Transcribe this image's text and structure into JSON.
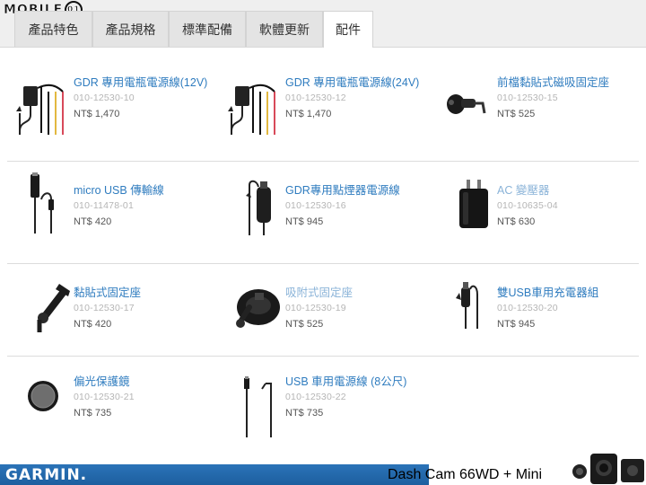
{
  "watermark": {
    "text": "MOBILE",
    "mark": "01"
  },
  "tabs": [
    {
      "label": "產品特色"
    },
    {
      "label": "產品規格"
    },
    {
      "label": "標準配備"
    },
    {
      "label": "軟體更新"
    },
    {
      "label": "配件",
      "active": true
    }
  ],
  "accessories": [
    {
      "name": "GDR 專用電瓶電源線(12V)",
      "sku": "010-12530-10",
      "price": "NT$ 1,470",
      "icon": "battery-cable-icon"
    },
    {
      "name": "GDR 專用電瓶電源線(24V)",
      "sku": "010-12530-12",
      "price": "NT$ 1,470",
      "icon": "battery-cable-icon"
    },
    {
      "name": "前檔黏貼式磁吸固定座",
      "sku": "010-12530-15",
      "price": "NT$ 525",
      "icon": "magnetic-mount-icon"
    },
    {
      "name": "micro USB 傳輸線",
      "sku": "010-11478-01",
      "price": "NT$ 420",
      "icon": "usb-cable-icon"
    },
    {
      "name": "GDR專用點煙器電源線",
      "sku": "010-12530-16",
      "price": "NT$ 945",
      "icon": "car-charger-icon"
    },
    {
      "name": "AC 變壓器",
      "sku": "010-10635-04",
      "price": "NT$ 630",
      "icon": "ac-adapter-icon",
      "muted": true
    },
    {
      "name": "黏貼式固定座",
      "sku": "010-12530-17",
      "price": "NT$ 420",
      "icon": "adhesive-mount-icon"
    },
    {
      "name": "吸附式固定座",
      "sku": "010-12530-19",
      "price": "NT$ 525",
      "icon": "suction-mount-icon",
      "muted": true
    },
    {
      "name": "雙USB車用充電器組",
      "sku": "010-12530-20",
      "price": "NT$ 945",
      "icon": "dual-usb-charger-icon"
    },
    {
      "name": "偏光保護鏡",
      "sku": "010-12530-21",
      "price": "NT$ 735",
      "icon": "polarizing-lens-icon"
    },
    {
      "name": "USB 車用電源線 (8公尺)",
      "sku": "010-12530-22",
      "price": "NT$ 735",
      "icon": "usb-power-cable-icon"
    }
  ],
  "footer": {
    "brand": "GARMIN.",
    "product": "Dash Cam 66WD + Mini",
    "brand_color": "#1f66a8"
  }
}
